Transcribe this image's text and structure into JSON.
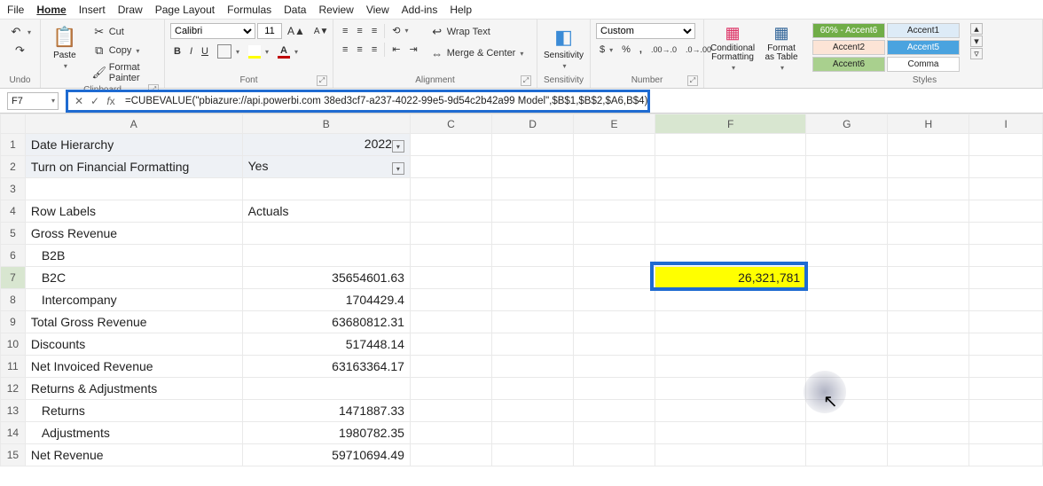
{
  "menu": {
    "items": [
      "File",
      "Home",
      "Insert",
      "Draw",
      "Page Layout",
      "Formulas",
      "Data",
      "Review",
      "View",
      "Add-ins",
      "Help"
    ],
    "selected": "Home"
  },
  "ribbon": {
    "undo": {
      "label": "Undo"
    },
    "clipboard": {
      "label": "Clipboard",
      "paste": "Paste",
      "cut": "Cut",
      "copy": "Copy",
      "formatPainter": "Format Painter"
    },
    "font": {
      "label": "Font",
      "name": "Calibri",
      "size": "11"
    },
    "alignment": {
      "label": "Alignment",
      "wrap": "Wrap Text",
      "merge": "Merge & Center"
    },
    "sensitivity": {
      "label": "Sensitivity",
      "btn": "Sensitivity"
    },
    "number": {
      "label": "Number",
      "format": "Custom"
    },
    "condfmt": {
      "label": "Conditional Formatting"
    },
    "fmtTable": {
      "label": "Format as Table"
    },
    "styles": {
      "label": "Styles",
      "items": [
        "60% - Accent6",
        "Accent1",
        "Accent2",
        "Accent5",
        "Accent6",
        "Comma"
      ]
    }
  },
  "formulaBar": {
    "nameBox": "F7",
    "formula": "=CUBEVALUE(\"pbiazure://api.powerbi.com 38ed3cf7-a237-4022-99e5-9d54c2b42a99 Model\",$B$1,$B$2,$A6,B$4)"
  },
  "columns": [
    "A",
    "B",
    "C",
    "D",
    "E",
    "F",
    "G",
    "H",
    "I"
  ],
  "selected": {
    "col": "F",
    "row": 7
  },
  "rows": [
    {
      "n": 1,
      "a": "Date Hierarchy",
      "b": "2022",
      "shade": true,
      "filter": true
    },
    {
      "n": 2,
      "a": "Turn on Financial Formatting",
      "b": "Yes",
      "shade": true,
      "filter": true
    },
    {
      "n": 3,
      "a": "",
      "b": ""
    },
    {
      "n": 4,
      "a": "Row Labels",
      "b": "Actuals"
    },
    {
      "n": 5,
      "a": "Gross Revenue",
      "b": ""
    },
    {
      "n": 6,
      "a": "B2B",
      "b": "",
      "indent": 1
    },
    {
      "n": 7,
      "a": "B2C",
      "b": "35654601.63",
      "indent": 1,
      "f": "26,321,781"
    },
    {
      "n": 8,
      "a": "Intercompany",
      "b": "1704429.4",
      "indent": 1
    },
    {
      "n": 9,
      "a": "Total Gross Revenue",
      "b": "63680812.31"
    },
    {
      "n": 10,
      "a": "Discounts",
      "b": "517448.14"
    },
    {
      "n": 11,
      "a": "Net Invoiced Revenue",
      "b": "63163364.17"
    },
    {
      "n": 12,
      "a": "Returns & Adjustments",
      "b": ""
    },
    {
      "n": 13,
      "a": "Returns",
      "b": "1471887.33",
      "indent": 1
    },
    {
      "n": 14,
      "a": "Adjustments",
      "b": "1980782.35",
      "indent": 1
    },
    {
      "n": 15,
      "a": "Net Revenue",
      "b": "59710694.49"
    }
  ],
  "colWidths": {
    "A": 260,
    "B": 200,
    "C": 100,
    "D": 100,
    "E": 100,
    "F": 180,
    "G": 100,
    "H": 100,
    "I": 90
  },
  "chart_data": null
}
